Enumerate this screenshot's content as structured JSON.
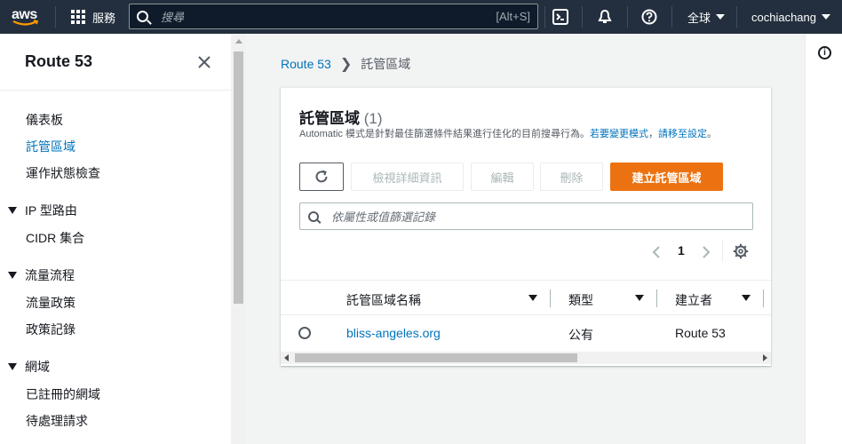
{
  "topnav": {
    "logo": "aws",
    "services_label": "服務",
    "search_placeholder": "搜尋",
    "search_shortcut": "[Alt+S]",
    "region_label": "全球",
    "user_label": "cochiachang",
    "icons": [
      "cloudshell-icon",
      "bell-icon",
      "help-icon"
    ]
  },
  "sidebar": {
    "title": "Route 53",
    "items": {
      "dashboard": "儀表板",
      "hosted_zones": "託管區域",
      "health_checks": "運作狀態檢查",
      "ip_routing": "IP 型路由",
      "cidr_collections": "CIDR 集合",
      "traffic_flow": "流量流程",
      "traffic_policies": "流量政策",
      "policy_records": "政策記錄",
      "domains": "網域",
      "registered_domains": "已註冊的網域",
      "pending_requests": "待處理請求"
    },
    "active": "hosted_zones"
  },
  "breadcrumb": {
    "root": "Route 53",
    "current": "託管區域"
  },
  "panel": {
    "title": "託管區域",
    "count": "(1)",
    "desc_prefix": "Automatic 模式是針對最佳篩選條件結果進行佳化的目前搜尋行為。",
    "desc_link1": "若要變更模式",
    "desc_mid": "，",
    "desc_link2": "請移至設定",
    "desc_suffix": "。",
    "buttons": {
      "view_details": "檢視詳細資訊",
      "edit": "編輯",
      "delete": "刪除",
      "create": "建立託管區域"
    },
    "filter_placeholder": "依屬性或值篩選記錄",
    "page_number": "1",
    "columns": [
      "託管區域名稱",
      "類型",
      "建立者"
    ],
    "rows": [
      {
        "name": "bliss-angeles.org",
        "type": "公有",
        "created_by": "Route 53"
      }
    ]
  },
  "colors": {
    "nav_bg": "#232f3e",
    "link": "#0073bb",
    "primary": "#ec7211"
  }
}
